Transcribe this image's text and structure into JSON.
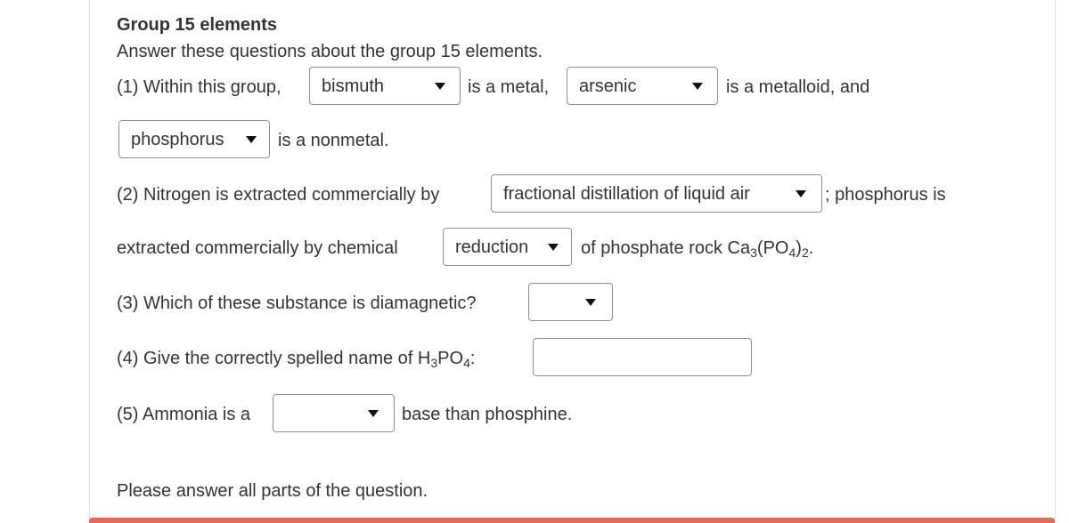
{
  "header": {
    "title": "Group 15 elements",
    "instructions": "Answer these questions about the group 15 elements."
  },
  "q1": {
    "prefix": "(1) Within this group,",
    "select_metal": "bismuth",
    "mid1": "is a metal,",
    "select_metalloid": "arsenic",
    "mid2": "is a metalloid, and",
    "select_nonmetal": "phosphorus",
    "suffix": "is a nonmetal."
  },
  "q2": {
    "prefix": "(2) Nitrogen is extracted commercially by",
    "select_nitrogen_method": "fractional distillation of liquid air",
    "mid": "; phosphorus is",
    "line2_prefix": "extracted commercially by chemical",
    "select_phosphorus_method": "reduction",
    "suffix_text": "of phosphate rock Ca",
    "formula_sub1": "3",
    "formula_mid": "(PO",
    "formula_sub2": "4",
    "formula_close": ")",
    "formula_sub3": "2",
    "formula_end": "."
  },
  "q3": {
    "question": "(3) Which of these substance is diamagnetic?",
    "select_value": ""
  },
  "q4": {
    "question_prefix": "(4) Give the correctly spelled name of H",
    "sub1": "3",
    "mid": "PO",
    "sub2": "4",
    "colon": ":",
    "input_value": ""
  },
  "q5": {
    "prefix": "(5) Ammonia is a",
    "select_value": "",
    "suffix": "base than phosphine."
  },
  "footer": {
    "message": "Please answer all parts of the question."
  },
  "colors": {
    "accent_bar": "#e46a54",
    "text": "#333333",
    "border": "#8f8f8f"
  },
  "icons": {
    "dropdown": "caret-down-icon"
  }
}
